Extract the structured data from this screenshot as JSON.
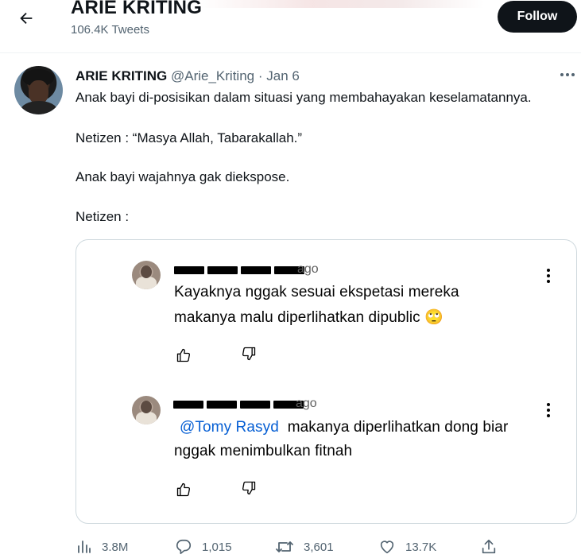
{
  "header": {
    "title": "ARIE KRITING",
    "tweet_count": "106.4K Tweets",
    "follow_label": "Follow"
  },
  "tweet": {
    "name": "ARIE KRITING",
    "handle": "@Arie_Kriting",
    "separator": "·",
    "date": "Jan 6",
    "lines": [
      "Anak bayi di-posisikan dalam situasi yang membahayakan keselamatannya.",
      "Netizen : “Masya Allah, Tabarakallah.”",
      "Anak bayi wajahnya gak diekspose.",
      "Netizen :"
    ]
  },
  "embedded_comments": [
    {
      "time": "ago",
      "text_line1": "Kayaknya nggak sesuai ekspetasi mereka",
      "text_line2": "makanya malu diperlihatkan dipublic 🙄"
    },
    {
      "time": "ago",
      "mention": "@Tomy Rasyd",
      "text_line1": "makanya diperlihatkan dong biar",
      "text_line2": "nggak menimbulkan fitnah"
    }
  ],
  "actions": {
    "views": "3.8M",
    "replies": "1,015",
    "retweets": "3,601",
    "likes": "13.7K"
  },
  "icons": {
    "back": "arrow-left-icon",
    "more": "more-horizontal-icon",
    "views": "bar-chart-icon",
    "reply": "speech-bubble-icon",
    "retweet": "retweet-icon",
    "like": "heart-icon",
    "share": "share-icon"
  }
}
